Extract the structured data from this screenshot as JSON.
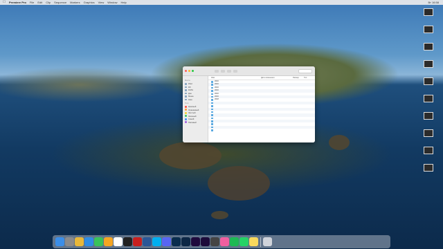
{
  "menubar": {
    "app_name": "Premiere Pro",
    "menus": [
      "File",
      "Edit",
      "Clip",
      "Sequence",
      "Markers",
      "Graphics",
      "View",
      "Window",
      "Help"
    ],
    "status_right": [
      "Вт 16:58"
    ]
  },
  "finder": {
    "title": "",
    "sidebar": {
      "favorites_heading": "Места",
      "items": [
        "iPad",
        "Dfl",
        "DATA",
        "Док",
        "Меню",
        "Наш"
      ],
      "tags_heading": "Теги",
      "tags": [
        {
          "label": "Красный",
          "color": "#ff4b3e"
        },
        {
          "label": "Оранжевый",
          "color": "#ff9b2f"
        },
        {
          "label": "Желтый",
          "color": "#f7cf2f"
        },
        {
          "label": "Зеленый",
          "color": "#35c759"
        },
        {
          "label": "Синий",
          "color": "#3a8ef6"
        },
        {
          "label": "Лиловый",
          "color": "#a05ce0"
        }
      ]
    },
    "columns": {
      "name": "Имя",
      "date": "Дата изменения",
      "size": "Размер",
      "kind": "Тип"
    },
    "rows": [
      {
        "name": "2016",
        "date": "",
        "size": "",
        "kind": ""
      },
      {
        "name": "2016",
        "date": "",
        "size": "",
        "kind": ""
      },
      {
        "name": "2016",
        "date": "",
        "size": "",
        "kind": ""
      },
      {
        "name": "2016",
        "date": "",
        "size": "",
        "kind": ""
      },
      {
        "name": "2016",
        "date": "",
        "size": "",
        "kind": ""
      },
      {
        "name": "2016",
        "date": "",
        "size": "",
        "kind": ""
      },
      {
        "name": "2018",
        "date": "",
        "size": "",
        "kind": ""
      },
      {
        "name": "",
        "date": "",
        "size": "",
        "kind": ""
      },
      {
        "name": "",
        "date": "",
        "size": "",
        "kind": ""
      },
      {
        "name": "",
        "date": "",
        "size": "",
        "kind": ""
      },
      {
        "name": "",
        "date": "",
        "size": "",
        "kind": ""
      },
      {
        "name": "",
        "date": "",
        "size": "",
        "kind": ""
      },
      {
        "name": "",
        "date": "",
        "size": "",
        "kind": ""
      },
      {
        "name": "",
        "date": "",
        "size": "",
        "kind": ""
      },
      {
        "name": "",
        "date": "",
        "size": "",
        "kind": ""
      },
      {
        "name": "",
        "date": "",
        "size": "",
        "kind": ""
      },
      {
        "name": "",
        "date": "",
        "size": "",
        "kind": ""
      }
    ]
  },
  "desktop_icons": [
    {
      "label": ""
    },
    {
      "label": ""
    },
    {
      "label": ""
    },
    {
      "label": ""
    },
    {
      "label": ""
    },
    {
      "label": ""
    },
    {
      "label": ""
    },
    {
      "label": ""
    },
    {
      "label": ""
    },
    {
      "label": ""
    }
  ],
  "dock": [
    {
      "name": "finder",
      "color": "#3b8ee8"
    },
    {
      "name": "launchpad",
      "color": "#8b8b8b"
    },
    {
      "name": "chrome",
      "color": "#e8b83a"
    },
    {
      "name": "safari",
      "color": "#2f8de4"
    },
    {
      "name": "messages",
      "color": "#39c25a"
    },
    {
      "name": "photos",
      "color": "#f5a623"
    },
    {
      "name": "calendar",
      "color": "#ffffff"
    },
    {
      "name": "terminal",
      "color": "#222222"
    },
    {
      "name": "filezilla",
      "color": "#c8201f"
    },
    {
      "name": "word",
      "color": "#2b5797"
    },
    {
      "name": "skype",
      "color": "#00aff0"
    },
    {
      "name": "discord",
      "color": "#5865f2"
    },
    {
      "name": "photoshop",
      "color": "#0a2d4d"
    },
    {
      "name": "lightroom",
      "color": "#0d2745"
    },
    {
      "name": "premiere",
      "color": "#1f0a3d"
    },
    {
      "name": "after-effects",
      "color": "#1c0b3a"
    },
    {
      "name": "fcp",
      "color": "#444444"
    },
    {
      "name": "itunes",
      "color": "#f05fa0"
    },
    {
      "name": "spotify",
      "color": "#1db954"
    },
    {
      "name": "whatsapp",
      "color": "#25d366"
    },
    {
      "name": "notes",
      "color": "#f7d85d"
    },
    {
      "name": "trash",
      "color": "#cfd3da"
    }
  ]
}
